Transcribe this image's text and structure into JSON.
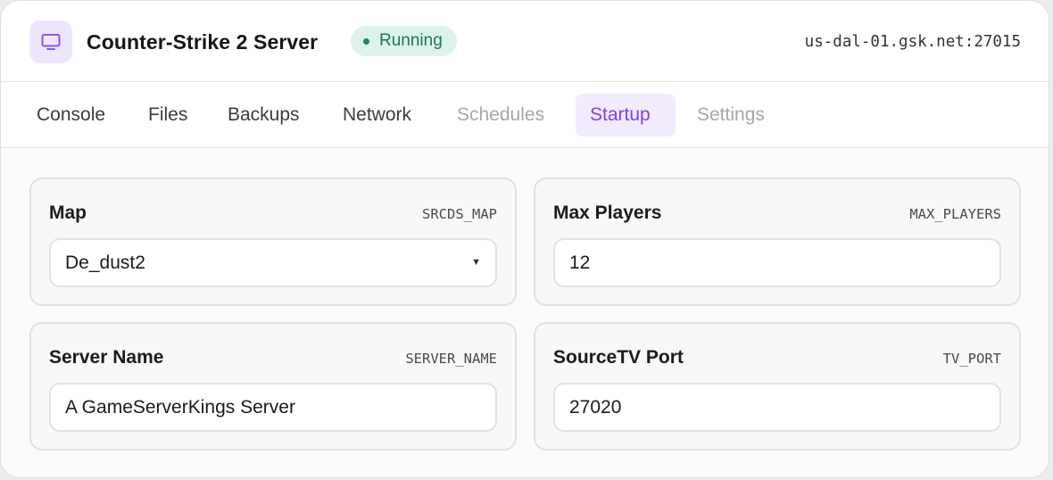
{
  "header": {
    "title": "Counter-Strike 2 Server",
    "status": "Running",
    "address": "us-dal-01.gsk.net:27015",
    "icon": "monitor-icon"
  },
  "tabs": [
    {
      "label": "Console",
      "state": "normal"
    },
    {
      "label": "Files",
      "state": "normal"
    },
    {
      "label": "Backups",
      "state": "normal"
    },
    {
      "label": "Network",
      "state": "normal"
    },
    {
      "label": "Schedules",
      "state": "disabled"
    },
    {
      "label": "Startup",
      "state": "active"
    },
    {
      "label": "Settings",
      "state": "disabled"
    }
  ],
  "variables": {
    "map": {
      "label": "Map",
      "var": "SRCDS_MAP",
      "value": "De_dust2",
      "type": "select"
    },
    "max_players": {
      "label": "Max Players",
      "var": "MAX_PLAYERS",
      "value": "12",
      "type": "text"
    },
    "server_name": {
      "label": "Server Name",
      "var": "SERVER_NAME",
      "value": "A GameServerKings Server",
      "type": "text"
    },
    "tv_port": {
      "label": "SourceTV Port",
      "var": "TV_PORT",
      "value": "27020",
      "type": "text"
    }
  },
  "colors": {
    "accent": "#8140e6",
    "accent_bg": "#f1ebfd",
    "status_text": "#1d7a4c",
    "status_bg": "#ddf3ea"
  }
}
